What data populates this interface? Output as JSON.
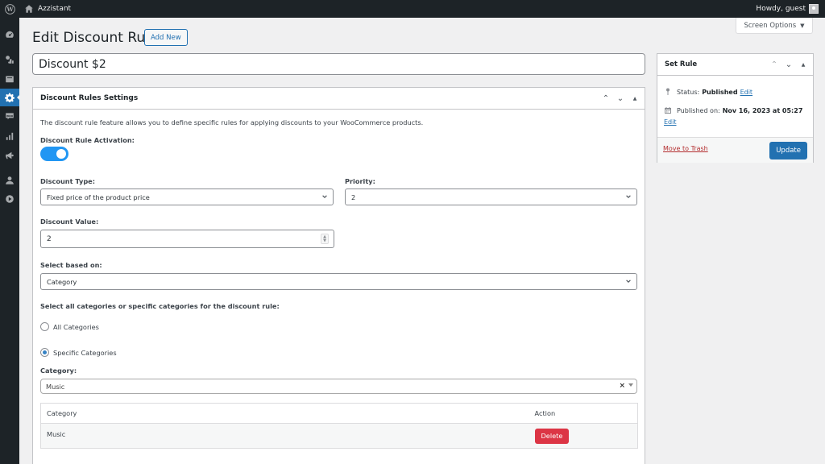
{
  "adminbar": {
    "site_name": "Azzistant",
    "greeting": "Howdy, guest"
  },
  "sidebar": {
    "items": [
      {
        "icon": "dashboard-icon",
        "active": false
      },
      {
        "icon": "posts-icon",
        "active": false
      },
      {
        "icon": "media-icon",
        "active": false
      },
      {
        "icon": "settings-gear-icon",
        "active": true
      },
      {
        "icon": "woocommerce-icon",
        "active": false
      },
      {
        "icon": "analytics-icon",
        "active": false
      },
      {
        "icon": "marketing-megaphone-icon",
        "active": false
      },
      {
        "icon": "users-icon",
        "active": false
      },
      {
        "icon": "media-play-icon",
        "active": false
      }
    ]
  },
  "header": {
    "title": "Edit Discount Rule",
    "add_new": "Add New",
    "screen_options": "Screen Options"
  },
  "post_title": "Discount $2",
  "settings_box": {
    "title": "Discount Rules Settings",
    "description": "The discount rule feature allows you to define specific rules for applying discounts to your WooCommerce products.",
    "activation_label": "Discount Rule Activation:",
    "activation_on": true,
    "discount_type_label": "Discount Type:",
    "discount_type_value": "Fixed price of the product price",
    "priority_label": "Priority:",
    "priority_value": "2",
    "discount_value_label": "Discount Value:",
    "discount_value": "2",
    "based_on_label": "Select based on:",
    "based_on_value": "Category",
    "categories_scope_label": "Select all categories or specific categories for the discount rule:",
    "radio_all": "All Categories",
    "radio_specific": "Specific Categories",
    "selected_scope": "specific",
    "category_label": "Category:",
    "category_value": "Music",
    "table": {
      "headers": [
        "Category",
        "Action"
      ],
      "rows": [
        {
          "category": "Music",
          "action": "Delete"
        }
      ]
    }
  },
  "publish_box": {
    "title": "Set Rule",
    "status_label": "Status:",
    "status_value": "Published",
    "status_edit": "Edit",
    "published_label": "Published on:",
    "published_value": "Nov 16, 2023 at 05:27",
    "published_edit": "Edit",
    "trash": "Move to Trash",
    "update": "Update"
  },
  "colors": {
    "admin_bar": "#1d2327",
    "accent": "#2271b1",
    "toggle_on": "#2196f3",
    "delete": "#dc3545",
    "trash": "#b32d2e"
  }
}
